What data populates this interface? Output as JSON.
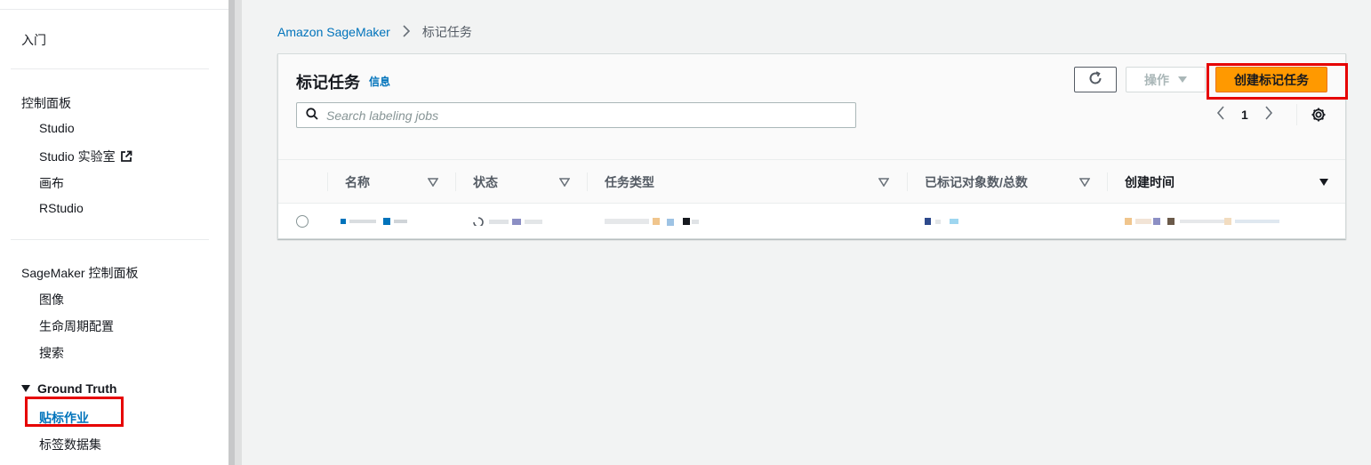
{
  "sidebar": {
    "getting_started": "入门",
    "control_panel": {
      "title": "控制面板",
      "items": [
        "Studio",
        "Studio 实验室",
        "画布",
        "RStudio"
      ]
    },
    "sagemaker_console": {
      "title": "SageMaker 控制面板",
      "items": [
        "图像",
        "生命周期配置",
        "搜索"
      ]
    },
    "ground_truth": {
      "title": "Ground Truth",
      "items": [
        "贴标作业",
        "标签数据集"
      ]
    }
  },
  "breadcrumb": {
    "root": "Amazon SageMaker",
    "current": "标记任务"
  },
  "panel": {
    "title": "标记任务",
    "info": "信息",
    "actions_label": "操作",
    "create_label": "创建标记任务",
    "search_placeholder": "Search labeling jobs",
    "page_number": "1"
  },
  "table": {
    "columns": [
      "名称",
      "状态",
      "任务类型",
      "已标记对象数/总数",
      "创建时间"
    ],
    "rows": [
      {
        "name": "",
        "status": "",
        "task_type": "",
        "labeled": "",
        "created": ""
      }
    ]
  },
  "colors": {
    "accent": "#0073bb",
    "primary_button": "#ff9900",
    "highlight": "#e60000"
  }
}
